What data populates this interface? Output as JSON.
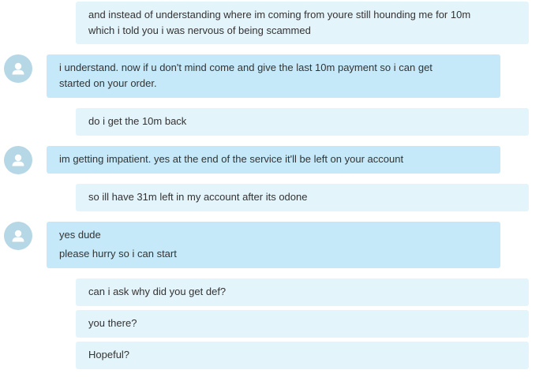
{
  "conversation": {
    "messages": [
      {
        "direction": "outgoing",
        "lines": [
          "and instead of understanding where im coming from youre still hounding me for 10m",
          "which i told you i was nervous of being scammed"
        ]
      },
      {
        "direction": "incoming",
        "lines": [
          "i understand. now if u don't mind come and give the last 10m payment so i can get",
          "started on your order."
        ]
      },
      {
        "direction": "outgoing",
        "lines": [
          "do i get the 10m back"
        ]
      },
      {
        "direction": "incoming",
        "lines": [
          "im getting impatient. yes at the end of the service it'll be left on your account"
        ]
      },
      {
        "direction": "outgoing",
        "lines": [
          "so ill have 31m left in my account after its odone"
        ]
      },
      {
        "direction": "incoming",
        "lines": [
          "yes dude",
          "please hurry so i can start"
        ]
      },
      {
        "direction": "outgoing",
        "lines": [
          "can i ask why did you get def?"
        ]
      },
      {
        "direction": "outgoing",
        "lines": [
          "you there?"
        ]
      },
      {
        "direction": "outgoing",
        "lines": [
          "Hopeful?"
        ]
      }
    ]
  },
  "avatar_icon": "default-user-avatar-icon",
  "colors": {
    "outgoing_bubble": "#e4f4fb",
    "incoming_bubble": "#c6e9f9",
    "avatar_bg": "#b6d7e6",
    "text": "#333333"
  }
}
